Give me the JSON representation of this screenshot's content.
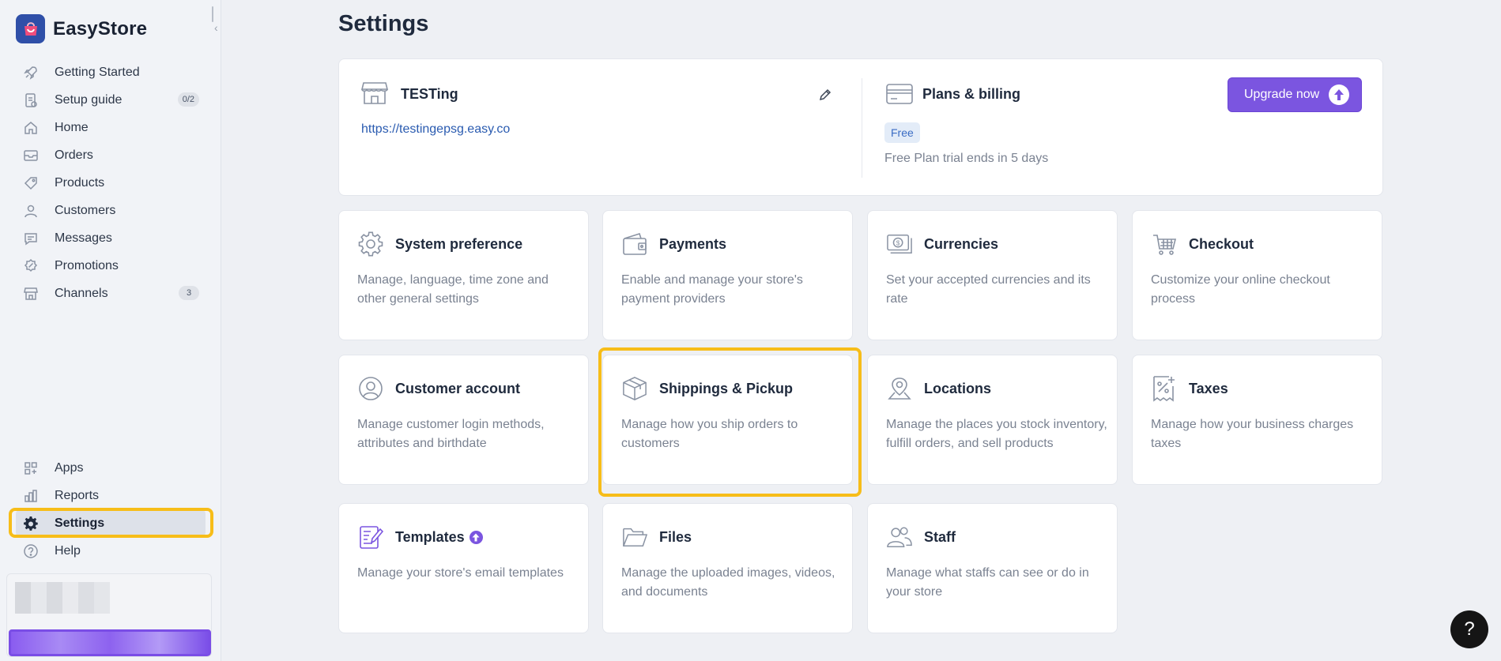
{
  "brand": {
    "name": "EasyStore"
  },
  "sidebar": {
    "items": [
      {
        "label": "Getting Started",
        "icon": "rocket-icon"
      },
      {
        "label": "Setup guide",
        "icon": "checklist-icon",
        "badge": "0/2"
      },
      {
        "label": "Home",
        "icon": "home-icon"
      },
      {
        "label": "Orders",
        "icon": "inbox-icon"
      },
      {
        "label": "Products",
        "icon": "tag-icon"
      },
      {
        "label": "Customers",
        "icon": "user-icon"
      },
      {
        "label": "Messages",
        "icon": "chat-icon"
      },
      {
        "label": "Promotions",
        "icon": "discount-icon"
      },
      {
        "label": "Channels",
        "icon": "storefront-icon",
        "badge": "3"
      }
    ],
    "bottom_items": [
      {
        "label": "Apps",
        "icon": "apps-icon"
      },
      {
        "label": "Reports",
        "icon": "bar-chart-icon"
      },
      {
        "label": "Settings",
        "icon": "gear-icon",
        "active": true
      },
      {
        "label": "Help",
        "icon": "help-circle-icon"
      }
    ]
  },
  "page": {
    "title": "Settings"
  },
  "store": {
    "name": "TESTing",
    "url": "https://testingepsg.easy.co",
    "plans_title": "Plans & billing",
    "plan_badge": "Free",
    "plan_note": "Free Plan trial ends in 5 days",
    "upgrade_label": "Upgrade now"
  },
  "cards": [
    {
      "title": "System preference",
      "desc": "Manage, language, time zone and other general settings",
      "icon": "gear-outline-icon"
    },
    {
      "title": "Payments",
      "desc": "Enable and manage your store's payment providers",
      "icon": "wallet-icon"
    },
    {
      "title": "Currencies",
      "desc": "Set your accepted currencies and its rate",
      "icon": "currency-icon"
    },
    {
      "title": "Checkout",
      "desc": "Customize your online checkout process",
      "icon": "cart-icon"
    },
    {
      "title": "Customer account",
      "desc": "Manage customer login methods, attributes and birthdate",
      "icon": "user-circle-icon"
    },
    {
      "title": "Shippings & Pickup",
      "desc": "Manage how you ship orders to customers",
      "icon": "package-icon"
    },
    {
      "title": "Locations",
      "desc": "Manage the places you stock inventory, fulfill orders, and sell products",
      "icon": "location-pin-icon"
    },
    {
      "title": "Taxes",
      "desc": "Manage how your business charges taxes",
      "icon": "tax-receipt-icon"
    },
    {
      "title": "Templates",
      "desc": "Manage your store's email templates",
      "icon": "template-edit-icon"
    },
    {
      "title": "Files",
      "desc": "Manage the uploaded images, videos, and documents",
      "icon": "folder-icon"
    },
    {
      "title": "Staff",
      "desc": "Manage what staffs can see or do in your store",
      "icon": "users-icon"
    }
  ],
  "colors": {
    "accent": "#7b55e0",
    "highlight": "#f7bd19",
    "link": "#2a5bb0"
  },
  "help_fab": {
    "label": "?"
  }
}
